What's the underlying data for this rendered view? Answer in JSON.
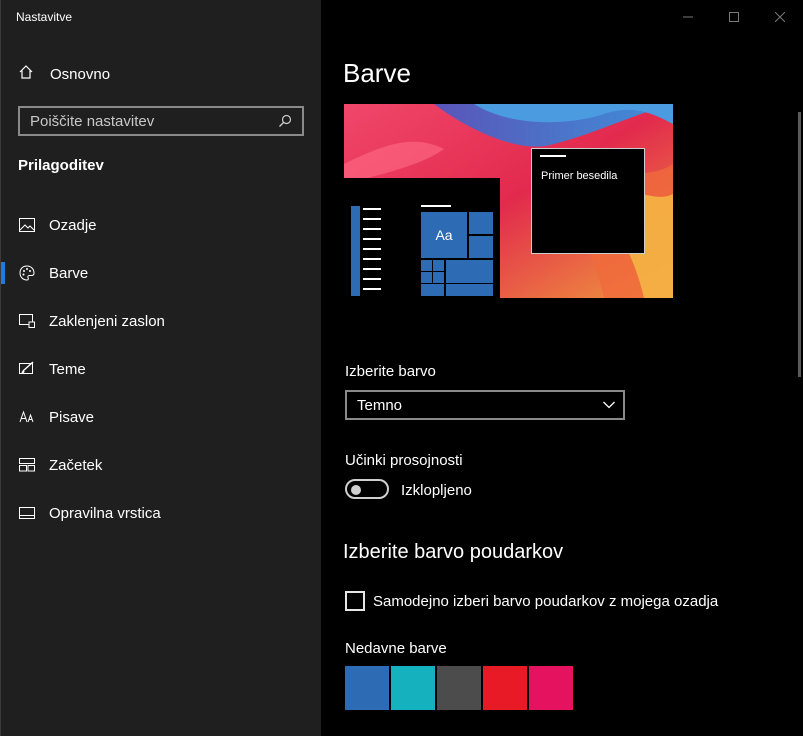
{
  "window": {
    "title": "Nastavitve"
  },
  "sidebar": {
    "home_label": "Osnovno",
    "search_placeholder": "Poiščite nastavitev",
    "section_title": "Prilagoditev",
    "items": [
      {
        "label": "Ozadje",
        "icon": "image-icon"
      },
      {
        "label": "Barve",
        "icon": "palette-icon",
        "selected": true
      },
      {
        "label": "Zaklenjeni zaslon",
        "icon": "lock-screen-icon"
      },
      {
        "label": "Teme",
        "icon": "themes-icon"
      },
      {
        "label": "Pisave",
        "icon": "fonts-icon"
      },
      {
        "label": "Začetek",
        "icon": "start-icon"
      },
      {
        "label": "Opravilna vrstica",
        "icon": "taskbar-icon"
      }
    ]
  },
  "main": {
    "title": "Barve",
    "preview": {
      "tile_label": "Aa",
      "sample_text": "Primer besedila"
    },
    "choose_color_label": "Izberite barvo",
    "choose_color_value": "Temno",
    "transparency_label": "Učinki prosojnosti",
    "transparency_state": "Izklopljeno",
    "accent_heading": "Izberite barvo poudarkov",
    "auto_accent_label": "Samodejno izberi barvo poudarkov z mojega ozadja",
    "recent_colors_label": "Nedavne barve",
    "recent_colors": [
      "#2d6cb4",
      "#16b1bf",
      "#4c4c4c",
      "#e81a25",
      "#e5125f"
    ]
  },
  "colors": {
    "accent": "#1c7ce0",
    "sidebar_bg": "#1f1f1f",
    "main_bg": "#000000"
  }
}
